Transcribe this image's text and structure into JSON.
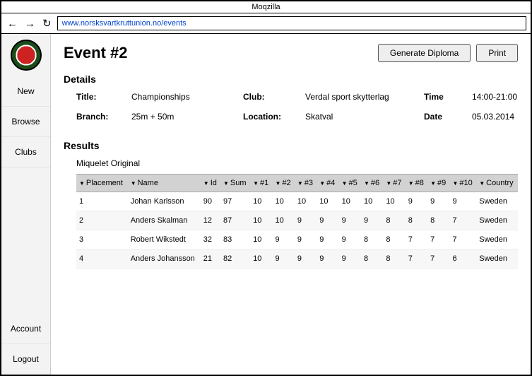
{
  "window": {
    "title": "Moqzilla"
  },
  "url": "www.norsksvartkruttunion.no/events",
  "sidebar": {
    "items": [
      "New",
      "Browse",
      "Clubs"
    ],
    "bottom": [
      "Account",
      "Logout"
    ]
  },
  "page": {
    "title": "Event #2",
    "buttons": {
      "diploma": "Generate Diploma",
      "print": "Print"
    },
    "details_heading": "Details",
    "details": {
      "title_label": "Title:",
      "title_value": "Championships",
      "club_label": "Club:",
      "club_value": "Verdal sport skytterlag",
      "time_label": "Time",
      "time_value": "14:00-21:00",
      "branch_label": "Branch:",
      "branch_value": "25m + 50m",
      "location_label": "Location:",
      "location_value": "Skatval",
      "date_label": "Date",
      "date_value": "05.03.2014"
    },
    "results_heading": "Results",
    "results_subhead": "Miquelet Original",
    "columns": [
      "Placement",
      "Name",
      "Id",
      "Sum",
      "#1",
      "#2",
      "#3",
      "#4",
      "#5",
      "#6",
      "#7",
      "#8",
      "#9",
      "#10",
      "Country"
    ],
    "rows": [
      {
        "placement": "1",
        "name": "Johan Karlsson",
        "id": "90",
        "sum": "97",
        "s": [
          "10",
          "10",
          "10",
          "10",
          "10",
          "10",
          "10",
          "9",
          "9",
          "9"
        ],
        "country": "Sweden"
      },
      {
        "placement": "2",
        "name": "Anders Skalman",
        "id": "12",
        "sum": "87",
        "s": [
          "10",
          "10",
          "9",
          "9",
          "9",
          "9",
          "8",
          "8",
          "8",
          "7"
        ],
        "country": "Sweden"
      },
      {
        "placement": "3",
        "name": "Robert Wikstedt",
        "id": "32",
        "sum": "83",
        "s": [
          "10",
          "9",
          "9",
          "9",
          "9",
          "8",
          "8",
          "7",
          "7",
          "7"
        ],
        "country": "Sweden"
      },
      {
        "placement": "4",
        "name": "Anders Johansson",
        "id": "21",
        "sum": "82",
        "s": [
          "10",
          "9",
          "9",
          "9",
          "9",
          "8",
          "8",
          "7",
          "7",
          "6"
        ],
        "country": "Sweden"
      }
    ]
  }
}
